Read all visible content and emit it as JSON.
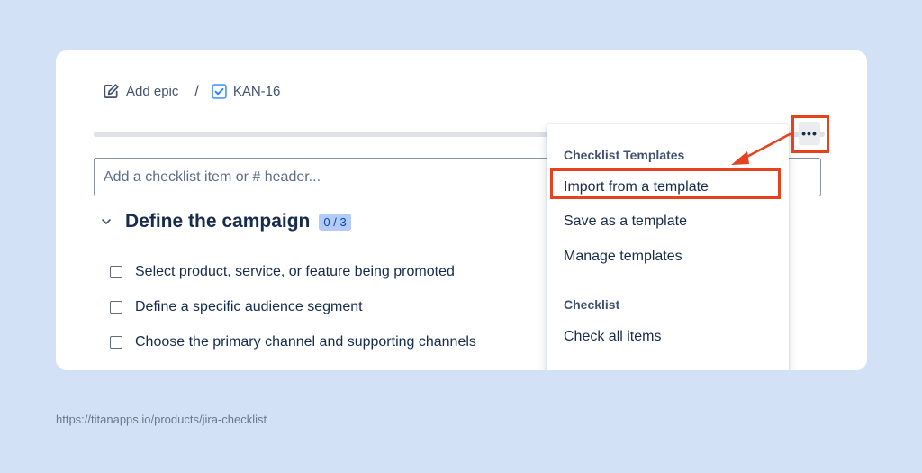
{
  "breadcrumb": {
    "epic_label": "Add epic",
    "separator": "/",
    "issue_key": "KAN-16"
  },
  "progress": {
    "percent": 0,
    "color": "#36b37e"
  },
  "checklist_input": {
    "placeholder": "Add a checklist item or # header...",
    "value": ""
  },
  "section": {
    "title": "Define the campaign",
    "count_badge": "0 / 3",
    "items": [
      {
        "label": "Select product, service, or feature being promoted",
        "checked": false
      },
      {
        "label": "Define a specific audience segment",
        "checked": false
      },
      {
        "label": "Choose the primary channel and supporting channels",
        "checked": false
      }
    ]
  },
  "more_button": {
    "glyph": "•••"
  },
  "menu": {
    "groups": [
      {
        "title": "Checklist Templates",
        "items": [
          "Import from a template",
          "Save as a template",
          "Manage templates"
        ]
      },
      {
        "title": "Checklist",
        "items": [
          "Check all items"
        ]
      }
    ],
    "highlighted_item": "Import from a template"
  },
  "annotation_color": "#e5421f",
  "footer": {
    "url": "https://titanapps.io/products/jira-checklist"
  },
  "icons": {
    "epic": "edit-icon",
    "issue": "checkbox-icon",
    "collapse": "chevron-down-icon",
    "more": "more-icon"
  }
}
